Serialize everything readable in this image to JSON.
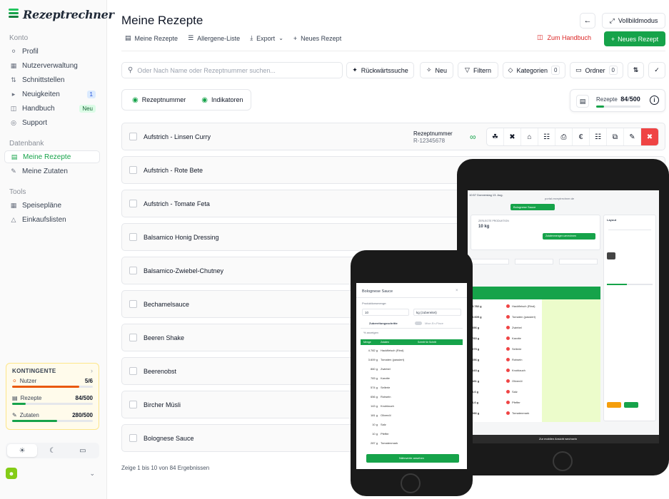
{
  "app": {
    "logo_text": "Rezeptrechner"
  },
  "sidebar": {
    "sections": [
      {
        "label": "Konto"
      },
      {
        "label": "Datenbank"
      },
      {
        "label": "Tools"
      }
    ],
    "items": [
      {
        "label": "Profil",
        "icon": "user-icon"
      },
      {
        "label": "Nutzerverwaltung",
        "icon": "building-icon"
      },
      {
        "label": "Schnittstellen",
        "icon": "plug-icon"
      },
      {
        "label": "Neuigkeiten",
        "icon": "megaphone-icon",
        "badge": "1"
      },
      {
        "label": "Handbuch",
        "icon": "book-icon",
        "badge": "Neu"
      },
      {
        "label": "Support",
        "icon": "support-icon"
      },
      {
        "label": "Meine Rezepte",
        "icon": "pot-icon"
      },
      {
        "label": "Meine Zutaten",
        "icon": "carrot-icon"
      },
      {
        "label": "Speisepläne",
        "icon": "calendar-icon"
      },
      {
        "label": "Einkaufslisten",
        "icon": "basket-icon"
      }
    ],
    "quota": {
      "title": "KONTINGENTE",
      "rows": [
        {
          "label": "Nutzer",
          "value": "5/6",
          "fraction": 0.83,
          "color": "#ea580c"
        },
        {
          "label": "Rezepte",
          "value": "84/500",
          "fraction": 0.17,
          "color": "#16a34a"
        },
        {
          "label": "Zutaten",
          "value": "280/500",
          "fraction": 0.56,
          "color": "#16a34a"
        }
      ]
    }
  },
  "header": {
    "title": "Meine Rezepte",
    "fullscreen_label": "Vollbildmodus",
    "subnav": [
      "Meine Rezepte",
      "Allergene-Liste",
      "Export",
      "Neues Rezept"
    ],
    "manual_label": "Zum Handbuch",
    "new_recipe_label": "Neues Rezept"
  },
  "toolbar": {
    "search_placeholder": "Oder Nach Name oder Rezeptnummer suchen...",
    "reverse_search": "Rückwärtssuche",
    "new": "Neu",
    "filter": "Filtern",
    "categories": "Kategorien",
    "categories_count": "0",
    "folders": "Ordner",
    "folders_count": "0"
  },
  "toggles": [
    "Rezeptnummer",
    "Indikatoren"
  ],
  "usage": {
    "label": "Rezepte",
    "used": "84",
    "total": "500",
    "fraction": 0.17
  },
  "recipes": [
    {
      "name": "Aufstrich - Linsen Curry",
      "number_label": "Rezeptnummer",
      "number": "R-12345678"
    },
    {
      "name": "Aufstrich - Rote Bete"
    },
    {
      "name": "Aufstrich - Tomate Feta"
    },
    {
      "name": "Balsamico Honig Dressing"
    },
    {
      "name": "Balsamico-Zwiebel-Chutney"
    },
    {
      "name": "Bechamelsauce"
    },
    {
      "name": "Beeren Shake"
    },
    {
      "name": "Beerenobst"
    },
    {
      "name": "Bircher Müsli"
    },
    {
      "name": "Bolognese Sauce"
    }
  ],
  "footer": "Zeige 1 bis 10 von 84 Ergebnissen",
  "phone": {
    "title": "Bolognese Sauce",
    "prod_label": "Produktionsmenge:",
    "qty": "10",
    "unit": "kg (zubereitet)",
    "steps": "Zubereitungsschritte",
    "mise": "Mise-En-Place",
    "percent": "% anzeigen",
    "cols": [
      "Menge",
      "Zutaten",
      "Schritt für Schritt"
    ],
    "ingredients": [
      [
        "4.782 g",
        "Hackfleisch (Rind)"
      ],
      [
        "3.609 g",
        "Tomaten (passiert)"
      ],
      [
        "860 g",
        "Zwiebel"
      ],
      [
        "783 g",
        "Karotte"
      ],
      [
        "574 g",
        "Sellerie"
      ],
      [
        "656 g",
        "Rotwein"
      ],
      [
        "143 g",
        "Knoblauch"
      ],
      [
        "181 g",
        "Olivenöl"
      ],
      [
        "10 g",
        "Salz"
      ],
      [
        "10 g",
        "Pfeffer"
      ],
      [
        "287 g",
        "Tomatenmark"
      ]
    ],
    "button": "Nährwerte ansehen"
  },
  "tablet": {
    "status_time": "10:57  Donnerstag 13. Aug.",
    "url": "portal.rezeptrechner.de",
    "recipe_tab": "Bolognese Sauce",
    "production_title": "ZERLEGTE PRODUKTION",
    "production_qty": "10 kg",
    "recalc_label": "Zutatenmengen umrechnen",
    "sidebar_title": "Layout",
    "ingredients": [
      [
        "4.782 g",
        "Hackfleisch (Rind)"
      ],
      [
        "3.609 g",
        "Tomaten (passiert)"
      ],
      [
        "856 g",
        "Zwiebel"
      ],
      [
        "783 g",
        "Karotte"
      ],
      [
        "575 g",
        "Sellerie"
      ],
      [
        "656 g",
        "Rotwein"
      ],
      [
        "143 g",
        "Knoblauch"
      ],
      [
        "181 g",
        "Olivenöl"
      ],
      [
        "8,6 g",
        "Salz"
      ],
      [
        "8,6 g",
        "Pfeffer"
      ],
      [
        "286 g",
        "Tomatenmark"
      ]
    ],
    "bottom_label": "Zur mobilen Ansicht wechseln"
  }
}
